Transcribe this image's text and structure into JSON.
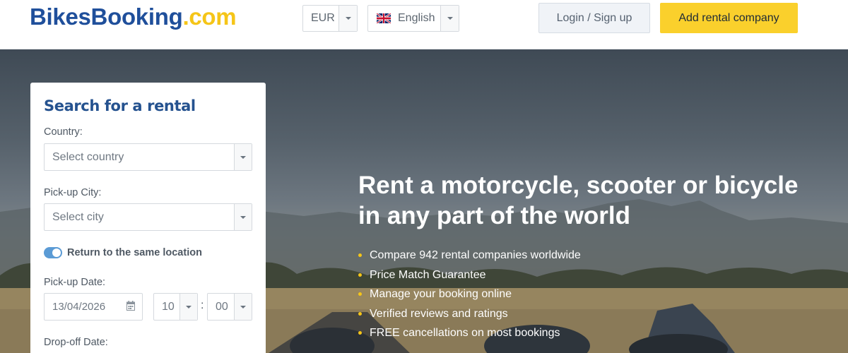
{
  "header": {
    "logo_main": "BikesBooking",
    "logo_suffix": ".com",
    "currency": "EUR",
    "language": "English",
    "login_label": "Login / Sign up",
    "add_company_label": "Add rental company"
  },
  "hero": {
    "title_line1": "Rent a motorcycle, scooter or bicycle",
    "title_line2": "in any part of the world",
    "features": [
      "Compare 942 rental companies worldwide",
      "Price Match Guarantee",
      "Manage your booking online",
      "Verified reviews and ratings",
      "FREE cancellations on most bookings"
    ]
  },
  "search": {
    "title": "Search for a rental",
    "country_label": "Country:",
    "country_placeholder": "Select country",
    "city_label": "Pick-up City:",
    "city_placeholder": "Select city",
    "return_same_label": "Return to the same location",
    "return_same_checked": true,
    "pickup_date_label": "Pick-up Date:",
    "pickup_date": "13/04/2026",
    "pickup_hour": "10",
    "pickup_minute": "00",
    "dropoff_date_label": "Drop-off Date:"
  },
  "colors": {
    "brand_blue": "#1f4f9b",
    "brand_yellow": "#f5c518",
    "cta_yellow": "#fad02c",
    "toggle_blue": "#5b9bd5"
  },
  "icons": [
    "uk-flag-icon",
    "chevron-down-icon",
    "calendar-icon"
  ]
}
